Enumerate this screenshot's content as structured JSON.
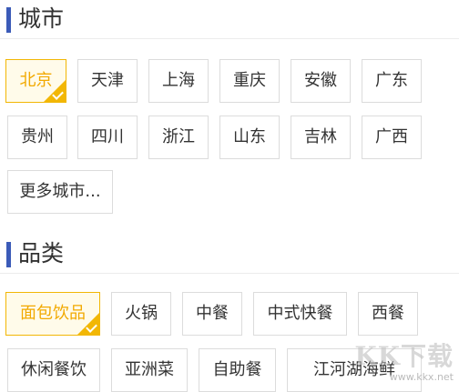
{
  "city_section": {
    "title": "城市",
    "tags": [
      "北京",
      "天津",
      "上海",
      "重庆",
      "安徽",
      "广东",
      "贵州",
      "四川",
      "浙江",
      "山东",
      "吉林",
      "广西"
    ],
    "more_label": "更多城市...",
    "selected": "北京"
  },
  "category_section": {
    "title": "品类",
    "tags": [
      "面包饮品",
      "火锅",
      "中餐",
      "中式快餐",
      "西餐",
      "休闲餐饮",
      "亚洲菜",
      "自助餐",
      "江河湖海鲜"
    ],
    "selected": "面包饮品"
  },
  "watermark": {
    "text": "KK下载",
    "url": "www.kkx.net"
  },
  "colors": {
    "accent": "#3b5bb8",
    "selected": "#f2b705"
  }
}
